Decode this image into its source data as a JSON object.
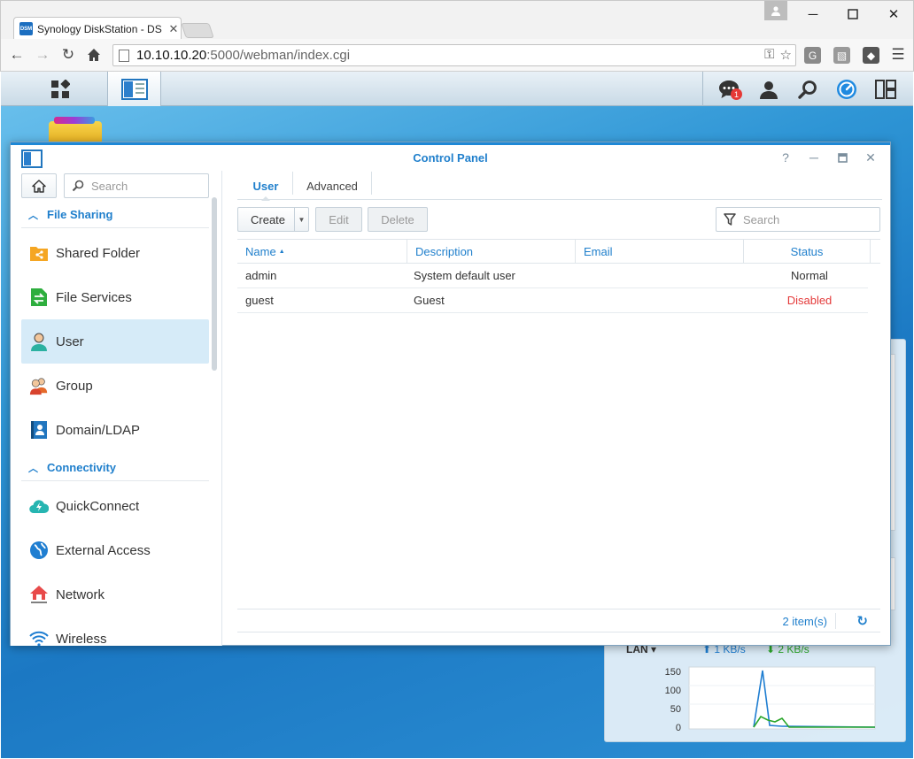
{
  "browser": {
    "tab_title": "Synology DiskStation - DS",
    "tab_favicon": "DSM",
    "url_host": "10.10.10.20",
    "url_rest": ":5000/webman/index.cgi",
    "extensions": [
      "G",
      "▧",
      "◆"
    ]
  },
  "taskbar": {
    "notification_count": "1"
  },
  "window": {
    "title": "Control Panel",
    "help": "?"
  },
  "sidebar": {
    "search_placeholder": "Search",
    "sections": [
      {
        "label": "File Sharing",
        "items": [
          "Shared Folder",
          "File Services",
          "User",
          "Group",
          "Domain/LDAP"
        ]
      },
      {
        "label": "Connectivity",
        "items": [
          "QuickConnect",
          "External Access",
          "Network",
          "Wireless"
        ]
      }
    ]
  },
  "main": {
    "tabs": [
      "User",
      "Advanced"
    ],
    "toolbar": {
      "create": "Create",
      "edit": "Edit",
      "delete": "Delete",
      "search_placeholder": "Search"
    },
    "columns": [
      "Name",
      "Description",
      "Email",
      "Status"
    ],
    "rows": [
      {
        "name": "admin",
        "description": "System default user",
        "email": "",
        "status": "Normal"
      },
      {
        "name": "guest",
        "description": "Guest",
        "email": "",
        "status": "Disabled"
      }
    ],
    "item_count": "2 item(s)"
  },
  "widget": {
    "lan_label": "LAN",
    "upload": "1 KB/s",
    "download": "2 KB/s",
    "y_ticks": [
      "150",
      "100",
      "50",
      "0"
    ]
  },
  "colors": {
    "accent": "#1f7fcc",
    "disabled": "#e43a3a",
    "selected_bg": "#d6ebf8"
  }
}
